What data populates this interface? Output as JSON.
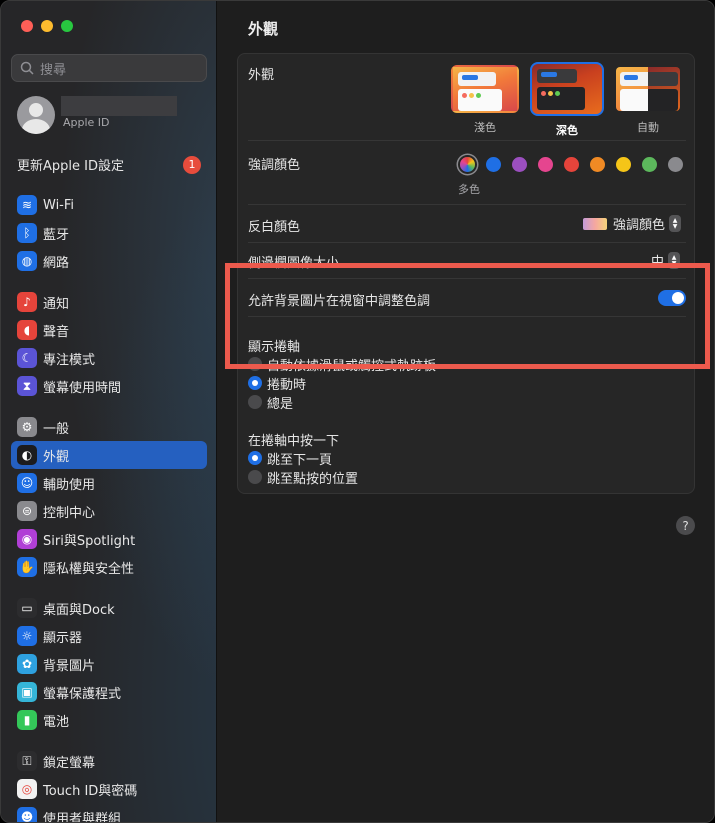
{
  "search": {
    "placeholder": "搜尋"
  },
  "profile": {
    "subtitle": "Apple ID"
  },
  "update": {
    "label": "更新Apple ID設定",
    "badge": "1"
  },
  "sidebar": {
    "items": [
      {
        "label": "Wi-Fi",
        "icon": "wifi-icon",
        "color": "#1f6fe5"
      },
      {
        "label": "藍牙",
        "icon": "bluetooth-icon",
        "color": "#1f6fe5"
      },
      {
        "label": "網路",
        "icon": "globe-icon",
        "color": "#1f6fe5"
      },
      {
        "label": "通知",
        "icon": "bell-icon",
        "color": "#e5443b"
      },
      {
        "label": "聲音",
        "icon": "speaker-icon",
        "color": "#e5443b"
      },
      {
        "label": "專注模式",
        "icon": "moon-icon",
        "color": "#5b54d6"
      },
      {
        "label": "螢幕使用時間",
        "icon": "hourglass-icon",
        "color": "#5b54d6"
      },
      {
        "label": "一般",
        "icon": "gear-icon",
        "color": "#8a8a8e"
      },
      {
        "label": "外觀",
        "icon": "appearance-icon",
        "color": "#1c1c1e"
      },
      {
        "label": "輔助使用",
        "icon": "accessibility-icon",
        "color": "#1f6fe5"
      },
      {
        "label": "控制中心",
        "icon": "toggles-icon",
        "color": "#8a8a8e"
      },
      {
        "label": "Siri與Spotlight",
        "icon": "siri-icon",
        "color": "#b13fd6"
      },
      {
        "label": "隱私權與安全性",
        "icon": "hand-icon",
        "color": "#1f6fe5"
      },
      {
        "label": "桌面與Dock",
        "icon": "dock-icon",
        "color": "#2c2c2e"
      },
      {
        "label": "顯示器",
        "icon": "sun-icon",
        "color": "#1f6fe5"
      },
      {
        "label": "背景圖片",
        "icon": "flower-icon",
        "color": "#2ea1e0"
      },
      {
        "label": "螢幕保護程式",
        "icon": "screensaver-icon",
        "color": "#35b5d8"
      },
      {
        "label": "電池",
        "icon": "battery-icon",
        "color": "#34c759"
      },
      {
        "label": "鎖定螢幕",
        "icon": "lock-icon",
        "color": "#2c2c2e"
      },
      {
        "label": "Touch ID與密碼",
        "icon": "fingerprint-icon",
        "color": "#f2f2f2"
      },
      {
        "label": "使用者與群組",
        "icon": "users-icon",
        "color": "#1f6fe5"
      }
    ],
    "selected": "外觀"
  },
  "main": {
    "title": "外觀",
    "appearance": {
      "label": "外觀",
      "options": [
        "淺色",
        "深色",
        "自動"
      ],
      "selected": "深色"
    },
    "accent": {
      "label": "強調顏色",
      "caption": "多色",
      "colors": [
        "multicolor",
        "#1f6fe5",
        "#9b4fbf",
        "#e5458f",
        "#e5443b",
        "#f08a24",
        "#f5c518",
        "#5cb85c",
        "#8a8a8e"
      ]
    },
    "highlight": {
      "label": "反白顏色",
      "value": "強調顏色"
    },
    "sidebar_icon_size": {
      "label": "側邊欄圖像大小",
      "value": "中"
    },
    "wallpaper_tint": {
      "label": "允許背景圖片在視窗中調整色調",
      "on": true
    },
    "show_scrollbars": {
      "label": "顯示捲軸",
      "options": [
        "自動依據滑鼠或觸控式軌跡板",
        "捲動時",
        "總是"
      ],
      "selected": 1
    },
    "click_scrollbar": {
      "label": "在捲軸中按一下",
      "options": [
        "跳至下一頁",
        "跳至點按的位置"
      ],
      "selected": 0
    },
    "help": "?"
  }
}
